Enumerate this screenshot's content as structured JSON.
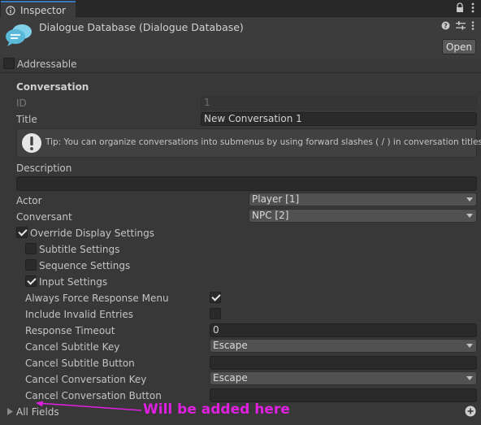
{
  "tab": {
    "label": "Inspector",
    "icon": "info-icon"
  },
  "tabbar_icons": [
    "lock-icon",
    "more-vertical-icon"
  ],
  "header": {
    "title": "Dialogue Database (Dialogue Database)",
    "icons": [
      "help-icon",
      "settings-sliders-icon",
      "more-vertical-icon"
    ],
    "open_label": "Open"
  },
  "addressable": {
    "label": "Addressable",
    "checked": false
  },
  "conversation": {
    "section_label": "Conversation",
    "id_label": "ID",
    "id_value": "1",
    "title_label": "Title",
    "title_value": "New Conversation 1",
    "tip": "Tip: You can organize conversations into submenus by using forward slashes ( / ) in conversation titles.",
    "description_label": "Description",
    "description_value": "",
    "actor_label": "Actor",
    "actor_value": "Player [1]",
    "conversant_label": "Conversant",
    "conversant_value": "NPC [2]",
    "override_label": "Override Display Settings",
    "subtitle_settings_label": "Subtitle Settings",
    "sequence_settings_label": "Sequence Settings",
    "input_settings_label": "Input Settings",
    "always_force_label": "Always Force Response Menu",
    "include_invalid_label": "Include Invalid Entries",
    "response_timeout_label": "Response Timeout",
    "response_timeout_value": "0",
    "cancel_subtitle_key_label": "Cancel Subtitle Key",
    "cancel_subtitle_key_value": "Escape",
    "cancel_subtitle_button_label": "Cancel Subtitle Button",
    "cancel_subtitle_button_value": "",
    "cancel_conversation_key_label": "Cancel Conversation Key",
    "cancel_conversation_key_value": "Escape",
    "cancel_conversation_button_label": "Cancel Conversation Button",
    "cancel_conversation_button_value": "",
    "all_fields_label": "All Fields"
  },
  "annotation": {
    "text": "Will be added here",
    "color": "#e020e0"
  }
}
